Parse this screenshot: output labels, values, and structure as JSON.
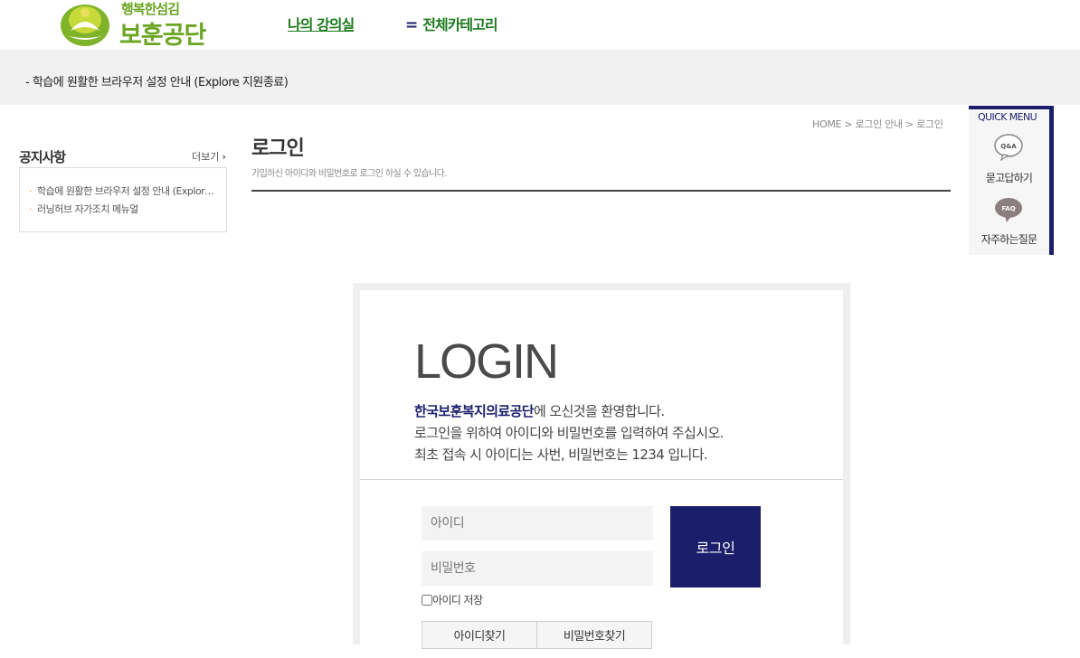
{
  "header": {
    "logo_small": "행복한섬김",
    "logo_big": "보훈공단",
    "nav_my_course": "나의 강의실",
    "nav_all_category_icon": "=",
    "nav_all_category": "전체카테고리"
  },
  "notice_bar": {
    "text": "- 학습에 원활한 브라우저 설정 안내 (Explore 지원종료)"
  },
  "sidebar": {
    "title": "공지사항",
    "more": "더보기",
    "items": [
      {
        "label": "학습에 원활한 브라우저 설정 안내 (Explore 지원종료)"
      },
      {
        "label": "러닝허브 자가조치 메뉴얼"
      }
    ]
  },
  "page": {
    "breadcrumb": "HOME > 로그인 안내 > 로그인",
    "title": "로그인",
    "description": "가입하신 아이디와 비밀번호로 로그인 하실 수 있습니다."
  },
  "quick_menu": {
    "title": "QUICK MENU",
    "qa_icon_text": "Q&A",
    "qa_label": "묻고답하기",
    "faq_icon_text": "FAQ",
    "faq_label": "자주하는질문"
  },
  "login": {
    "heading": "LOGIN",
    "org_name": "한국보훈복지의료공단",
    "welcome_suffix": "에 오신것을 환영합니다.",
    "line2": "로그인을 위하여 아이디와 비밀번호를 입력하여 주십시오.",
    "line3": "최초 접속 시 아이디는 사번, 비밀번호는 1234 입니다.",
    "id_placeholder": "아이디",
    "pw_placeholder": "비밀번호",
    "login_button": "로그인",
    "save_id_label": "아이디 저장",
    "find_id_button": "아이디찾기",
    "find_pw_button": "비밀번호찾기"
  },
  "colors": {
    "brand_green": "#6aa523",
    "nav_green": "#1c7a1c",
    "navy": "#1b1f6b",
    "bullet_orange": "#e89a28"
  }
}
